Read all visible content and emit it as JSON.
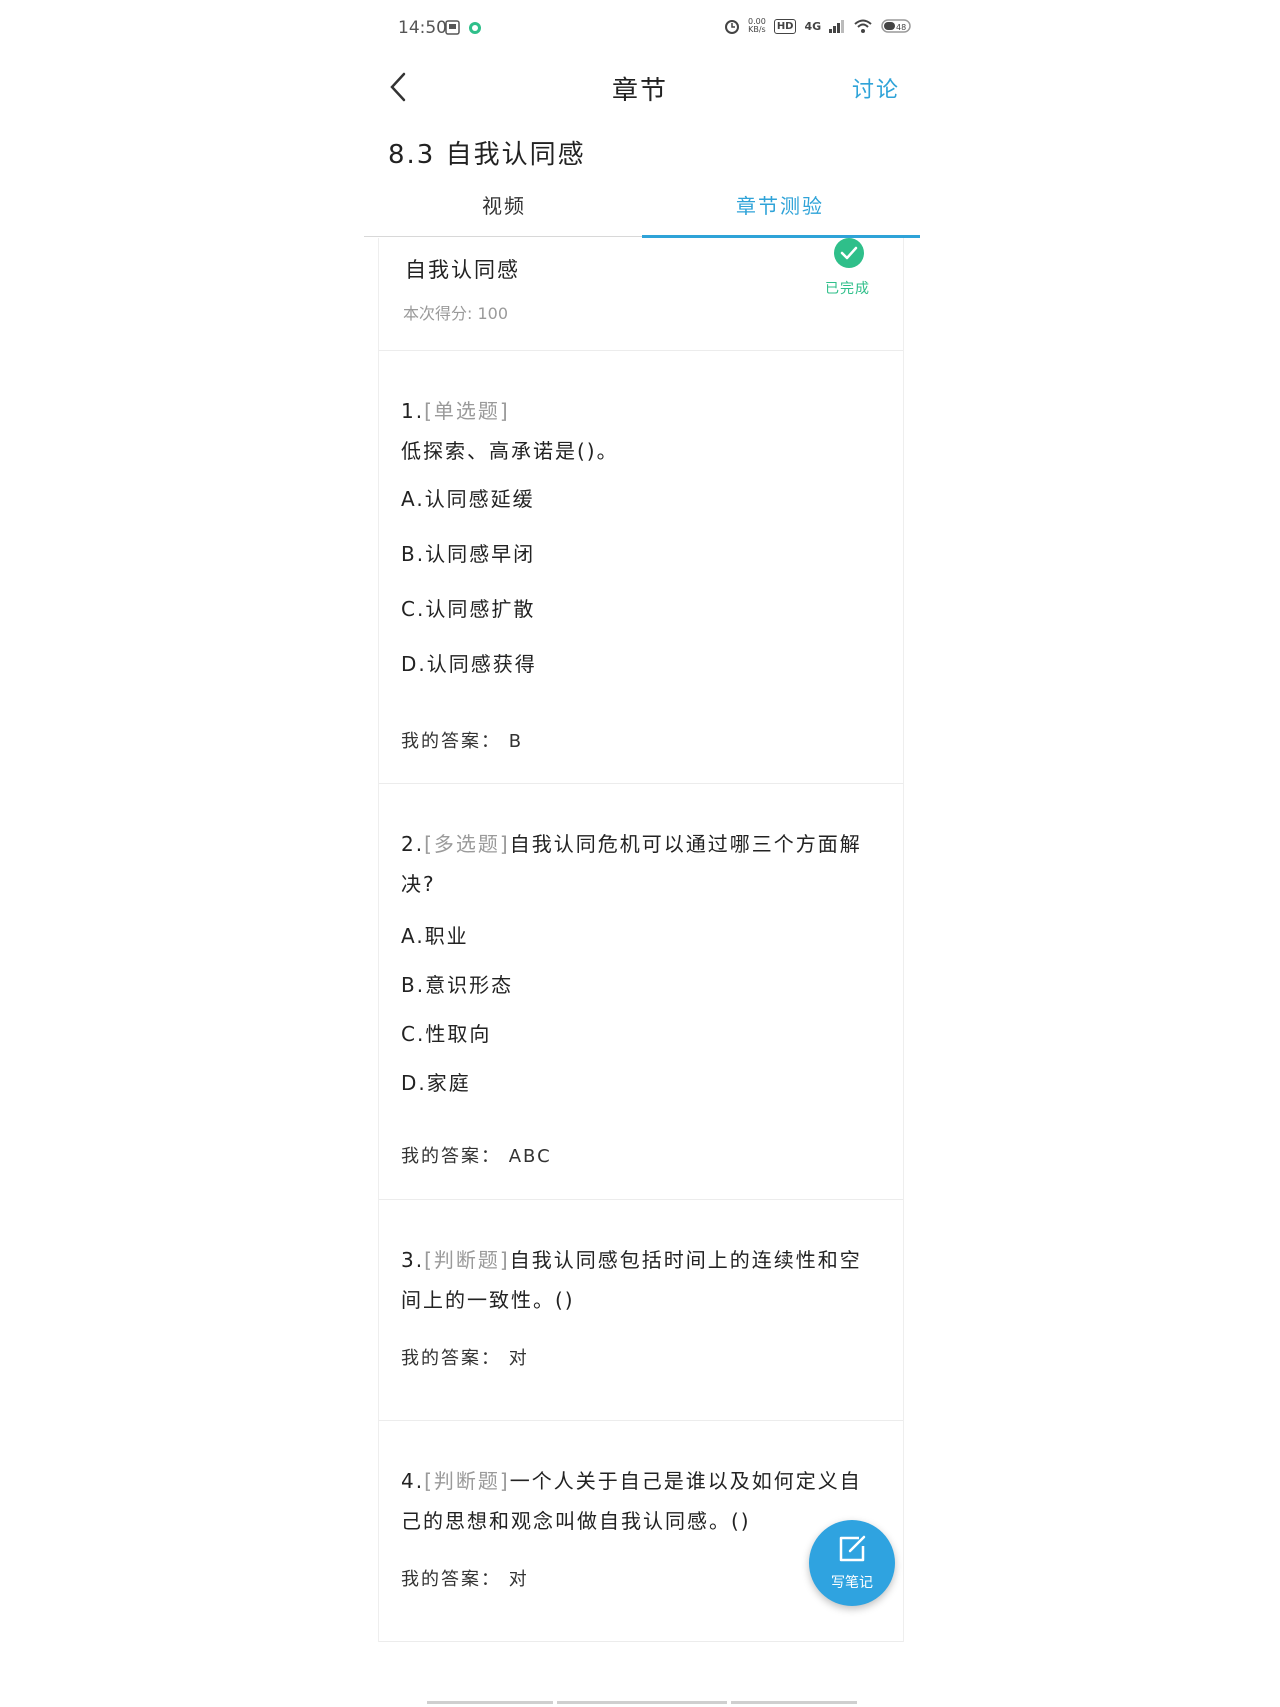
{
  "status_bar": {
    "time": "14:50",
    "net_speed": "0.00\nKB/s",
    "hd": "HD",
    "network": "4G",
    "battery": "48"
  },
  "header": {
    "title": "章节",
    "discuss": "讨论"
  },
  "section_title": "8.3 自我认同感",
  "tabs": [
    {
      "label": "视频",
      "active": false
    },
    {
      "label": "章节测验",
      "active": true
    }
  ],
  "quiz": {
    "name": "自我认同感",
    "score": "本次得分: 100",
    "status": "已完成"
  },
  "questions": [
    {
      "number": "1.",
      "type": "[单选题]",
      "text": "低探索、高承诺是()。",
      "options": [
        "A.认同感延缓",
        "B.认同感早闭",
        "C.认同感扩散",
        "D.认同感获得"
      ],
      "answer": "我的答案：  B"
    },
    {
      "number": "2.",
      "type": "[多选题]",
      "text": "自我认同危机可以通过哪三个方面解决?",
      "options": [
        "A.职业",
        "B.意识形态",
        "C.性取向",
        "D.家庭"
      ],
      "answer": "我的答案：  ABC"
    },
    {
      "number": "3.",
      "type": "[判断题]",
      "text": "自我认同感包括时间上的连续性和空间上的一致性。()",
      "options": [],
      "answer": "我的答案： 对"
    },
    {
      "number": "4.",
      "type": "[判断题]",
      "text": "一个人关于自己是谁以及如何定义自己的思想和观念叫做自我认同感。()",
      "options": [],
      "answer": "我的答案： 对"
    }
  ],
  "note_button": {
    "label": "写笔记"
  },
  "colors": {
    "accent": "#2fa3d8",
    "success": "#2fbf8a"
  }
}
